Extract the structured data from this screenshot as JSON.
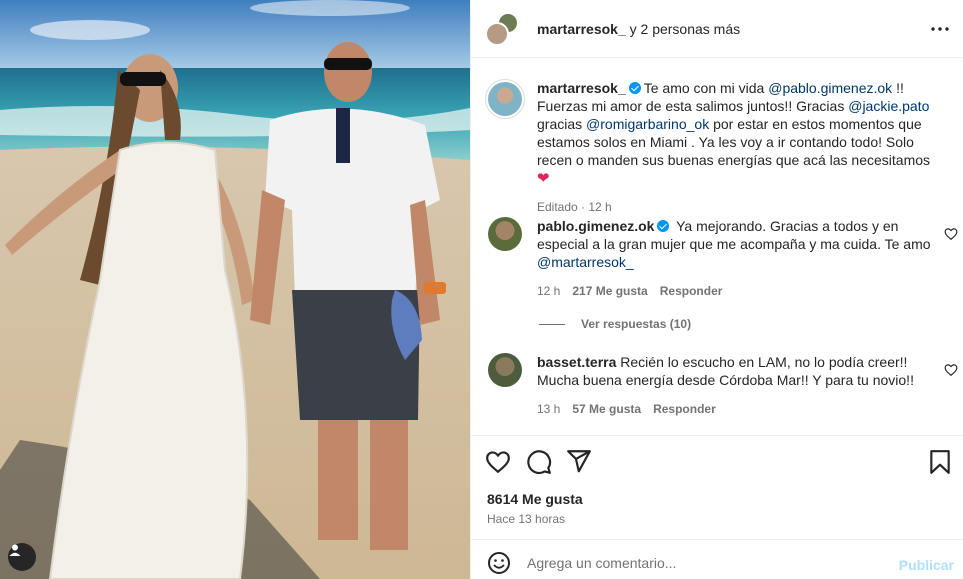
{
  "header": {
    "username": "martarresok_",
    "others": "y 2 personas más"
  },
  "caption": {
    "username": "martarresok_",
    "segments": {
      "s1": "Te amo con mi vida ",
      "m1": "@pablo.gimenez.ok",
      "s2": " !! Fuerzas mi amor de esta salimos juntos!! Gracias ",
      "m2": "@jackie.pato",
      "s3": " gracias ",
      "m3": "@romigarbarino_ok",
      "s4": " por estar en estos momentos que estamos solos en Miami . Ya les voy a ir contando todo! Solo recen o manden sus buenas energías que acá las necesitamos ",
      "emoji": "❤"
    },
    "edited": "Editado",
    "time": "12 h"
  },
  "comments": [
    {
      "username": "pablo.gimenez.ok",
      "text": " Ya mejorando. Gracias a todos y en especial a la gran mujer que me acompaña y ma cuida. Te amo ",
      "mention": "@martarresok_",
      "time": "12 h",
      "likes": "217 Me gusta",
      "reply": "Responder",
      "view_replies": "Ver respuestas (10)"
    },
    {
      "username": "basset.terra",
      "text": "Recién lo escucho en LAM, no lo podía creer!! Mucha buena energía desde Córdoba Mar!! Y para tu novio!!",
      "time": "13 h",
      "likes": "57 Me gusta",
      "reply": "Responder"
    }
  ],
  "post": {
    "likes": "8614 Me gusta",
    "time_ago": "Hace 13 horas"
  },
  "comment_box": {
    "placeholder": "Agrega un comentario...",
    "post_label": "Publicar"
  },
  "colors": {
    "link": "#00376b",
    "verified": "#0095f6",
    "muted": "#737373",
    "post_disabled": "#b2dffc"
  },
  "icons": [
    "user-tag-icon",
    "more-icon",
    "verified-icon",
    "heart-icon",
    "comment-icon",
    "share-icon",
    "bookmark-icon",
    "emoji-icon"
  ]
}
